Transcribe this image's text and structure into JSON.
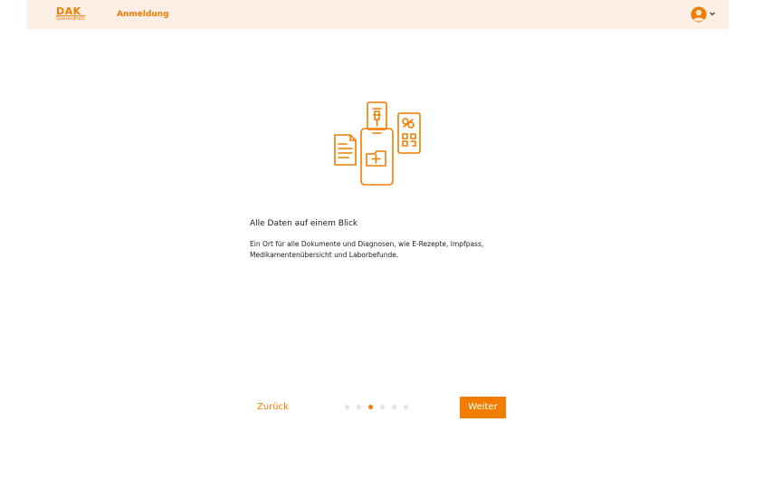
{
  "header": {
    "logo_main": "DAK",
    "logo_sub": "Gesundheit",
    "title": "Anmeldung",
    "avatar_icon": "user-avatar-icon",
    "menu_icon": "chevron-down-icon"
  },
  "main": {
    "illustration_icon": "health-documents-illustration",
    "headline": "Alle Daten auf einem Blick",
    "body_line_1": "Ein Ort für alle Dokumente und Diagnosen, wie E-Rezepte, Impfpass,",
    "body_line_2": "Medikamentenübersicht und Laborbefunde."
  },
  "footer_nav": {
    "back_label": "Zurück",
    "next_label": "Weiter",
    "pagination": {
      "total_steps": 6,
      "active_step": 3
    }
  },
  "colors": {
    "accent": "#f07d00",
    "header_bg": "#fdeee6",
    "dot_inactive": "#e2e2e2",
    "text": "#1c1c1c"
  }
}
